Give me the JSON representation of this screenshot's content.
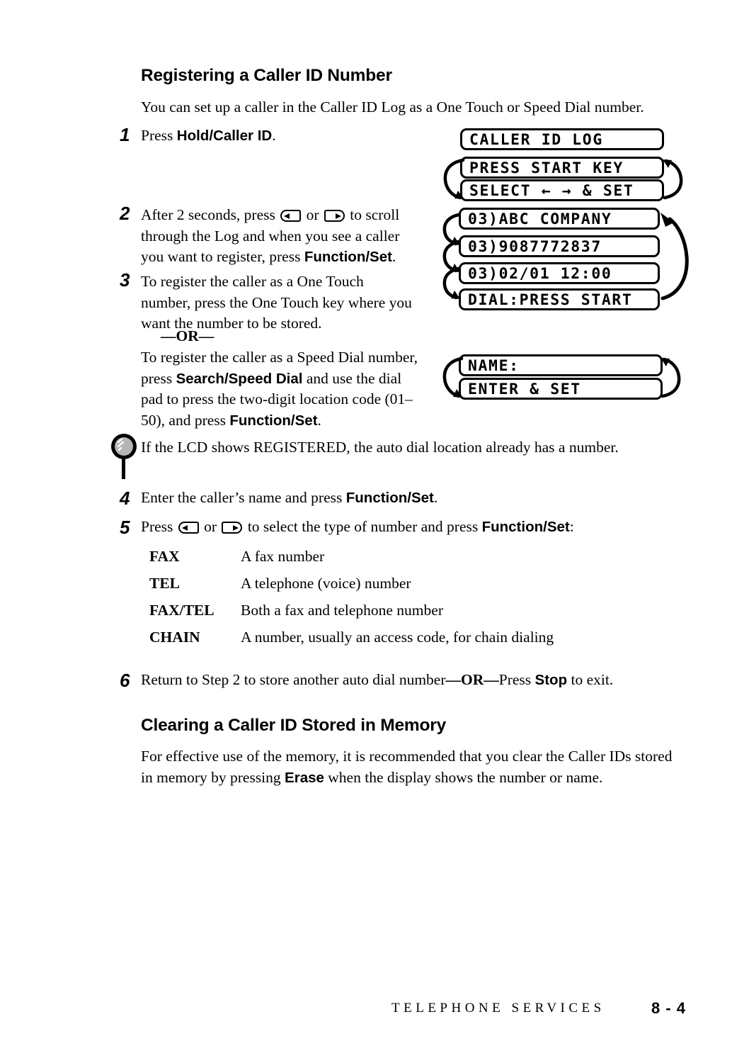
{
  "document": {
    "section1_heading": "Registering a Caller ID Number",
    "intro": "You can set up a caller in the Caller ID Log as a One Touch or Speed Dial number.",
    "section2_heading": "Clearing a Caller ID Stored in Memory",
    "section2_body_line1": "For effective use of the memory, it is recommended that you clear the Caller IDs stored",
    "section2_body_line2_pre": "in memory by pressing ",
    "section2_body_line2_bold": "Erase",
    "section2_body_line2_post": " when the display shows the number or name."
  },
  "steps": {
    "n1": "1",
    "n2": "2",
    "n3": "3",
    "n4": "4",
    "n5": "5",
    "n6": "6",
    "step1": {
      "pre": "Press ",
      "bold": "Hold/Caller ID",
      "post": "."
    },
    "step2": {
      "line1_pre": "After 2 seconds, press ",
      "line1_mid": " or ",
      "line1_post": " to scroll",
      "line2": "through the Log and when you see a caller",
      "line3_pre": "you want to register, press ",
      "line3_bold": "Function/Set",
      "line3_post": "."
    },
    "step3": {
      "line1": "To register the caller as a One Touch",
      "line2": "number, press the One Touch key where you",
      "line3": "want the number to be stored.",
      "or": "—OR—",
      "line4": "To register the caller as a Speed Dial number,",
      "line5_pre": "press ",
      "line5_bold": "Search/Speed Dial",
      "line5_post": " and use the dial",
      "line6": "pad to press the two-digit location code (01–",
      "line7_pre": "50), and press ",
      "line7_bold": "Function/Set",
      "line7_post": "."
    },
    "note": "If the LCD shows REGISTERED, the auto dial location already has a number.",
    "step4": {
      "pre": "Enter the caller’s name and press ",
      "bold": "Function/Set",
      "post": "."
    },
    "step5": {
      "pre": "Press ",
      "mid": " or ",
      "post": " to select the type of number and press ",
      "bold": "Function/Set",
      "end": ":"
    },
    "step6": {
      "pre": "Return to Step 2 to store another auto dial number",
      "or": "—OR—",
      "mid": "Press ",
      "bold": "Stop",
      "post": " to exit."
    }
  },
  "number_types": [
    {
      "term": "FAX",
      "desc": "A fax number"
    },
    {
      "term": "TEL",
      "desc": "A telephone (voice) number"
    },
    {
      "term": "FAX/TEL",
      "desc": "Both a fax and telephone number"
    },
    {
      "term": "CHAIN",
      "desc": "A number, usually an access code, for chain dialing"
    }
  ],
  "lcd_group1": [
    {
      "text": "CALLER ID LOG"
    },
    {
      "text": "PRESS START KEY"
    },
    {
      "text": "SELECT ← → & SET"
    }
  ],
  "lcd_group2": [
    {
      "text": "03)ABC COMPANY"
    },
    {
      "text": "03)9087772837"
    },
    {
      "text": "03)02/01 12:00"
    },
    {
      "text": "DIAL:PRESS START"
    }
  ],
  "lcd_group3": [
    {
      "text": "NAME:"
    },
    {
      "text": "ENTER & SET"
    }
  ],
  "footer": {
    "title": "TELEPHONE SERVICES",
    "page": "8 - 4"
  },
  "colors": {
    "ink": "#000000",
    "paper": "#ffffff",
    "pin_fill": "#b5b5b5"
  }
}
